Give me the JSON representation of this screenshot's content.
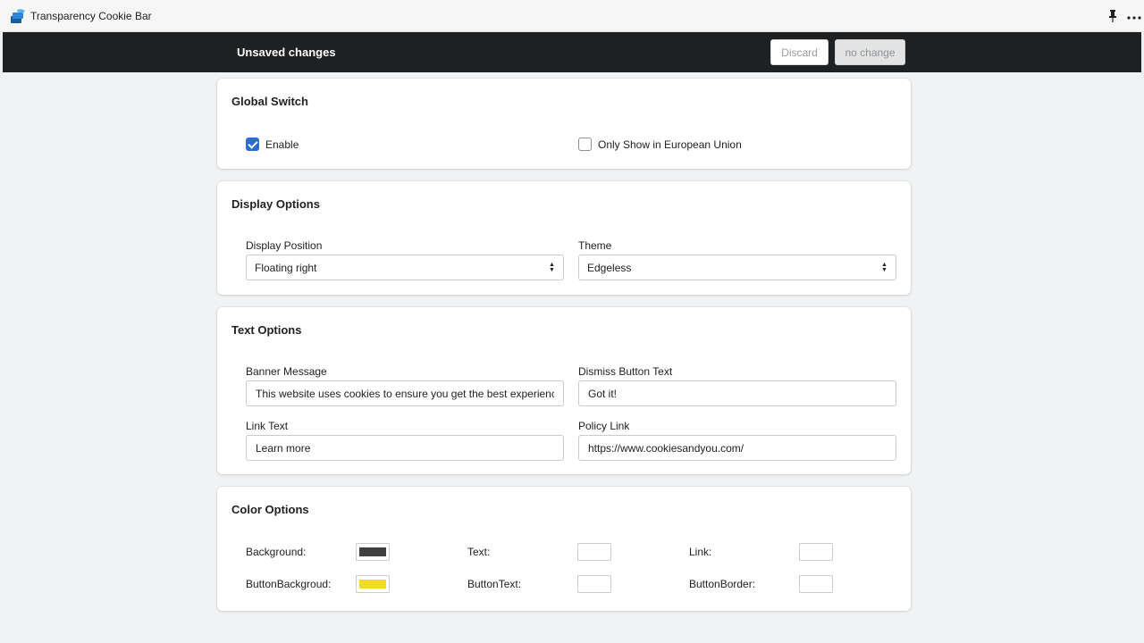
{
  "app": {
    "title": "Transparency Cookie Bar",
    "pin_glyph": "📌",
    "more_glyph": "•••"
  },
  "save_bar": {
    "title": "Unsaved changes",
    "discard_label": "Discard",
    "save_label": "no change"
  },
  "global_switch": {
    "title": "Global Switch",
    "enable_label": "Enable",
    "enable_checked": true,
    "eu_label": "Only Show in European Union",
    "eu_checked": false
  },
  "display_options": {
    "title": "Display Options",
    "position_label": "Display Position",
    "position_value": "Floating right",
    "theme_label": "Theme",
    "theme_value": "Edgeless"
  },
  "text_options": {
    "title": "Text Options",
    "banner_label": "Banner Message",
    "banner_value": "This website uses cookies to ensure you get the best experience on our website.",
    "dismiss_label": "Dismiss Button Text",
    "dismiss_value": "Got it!",
    "link_text_label": "Link Text",
    "link_text_value": "Learn more",
    "policy_label": "Policy Link",
    "policy_value": "https://www.cookiesandyou.com/"
  },
  "color_options": {
    "title": "Color Options",
    "background_label": "Background:",
    "background_color": "#3f3f3f",
    "text_label": "Text:",
    "text_color": "#ffffff",
    "link_label": "Link:",
    "link_color": "#ffffff",
    "button_bg_label": "ButtonBackgroud:",
    "button_bg_color": "#f1d930",
    "button_text_label": "ButtonText:",
    "button_text_color": "#ffffff",
    "button_border_label": "ButtonBorder:",
    "button_border_color": "#ffffff"
  },
  "colors": {
    "accent": "#2c6ecb",
    "save_bar_bg": "#1f2022"
  }
}
